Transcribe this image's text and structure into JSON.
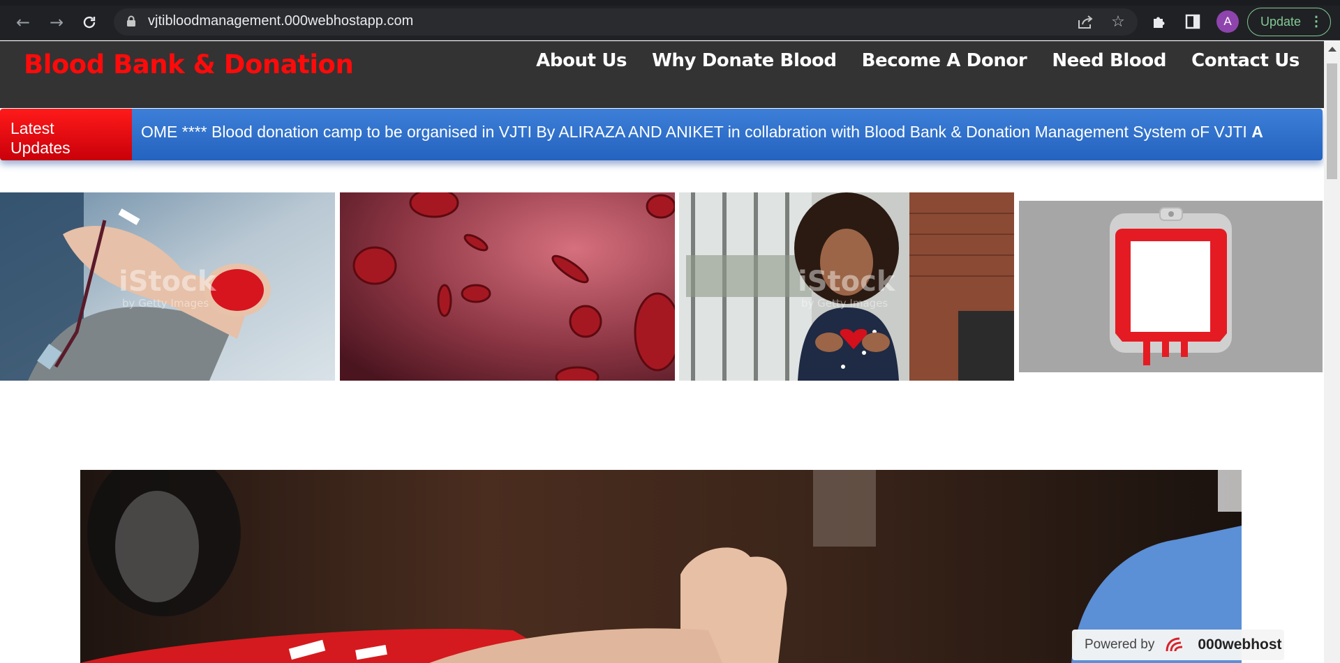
{
  "browser": {
    "url": "vjtibloodmanagement.000webhostapp.com",
    "avatar_initial": "A",
    "update_label": "Update",
    "icons": [
      "back-arrow-icon",
      "forward-arrow-icon",
      "reload-icon",
      "lock-icon",
      "share-icon",
      "bookmark-star-icon",
      "extensions-puzzle-icon",
      "side-panel-icon",
      "more-menu-icon"
    ]
  },
  "site": {
    "brand": "Blood Bank & Donation",
    "nav": [
      {
        "label": "About Us"
      },
      {
        "label": "Why Donate Blood"
      },
      {
        "label": "Become A Donor"
      },
      {
        "label": "Need Blood"
      },
      {
        "label": "Contact Us"
      }
    ],
    "ticker": {
      "label": "Latest Updates",
      "text": "OME **** Blood donation camp to be organised in VJTI By ALIRAZA AND ANIKET in collabration with Blood Bank & Donation Management System oF VJTI",
      "next_letter": "A"
    },
    "gallery": {
      "watermark_main": "iStock",
      "watermark_sub": "by Getty Images"
    },
    "powered_by": {
      "label": "Powered by",
      "brand": "000webhost"
    }
  },
  "colors": {
    "brand_red": "#ff0a0a",
    "header_bg": "#333333",
    "ticker_blue": "#2e6fcc",
    "ticker_red": "#e60a12"
  }
}
